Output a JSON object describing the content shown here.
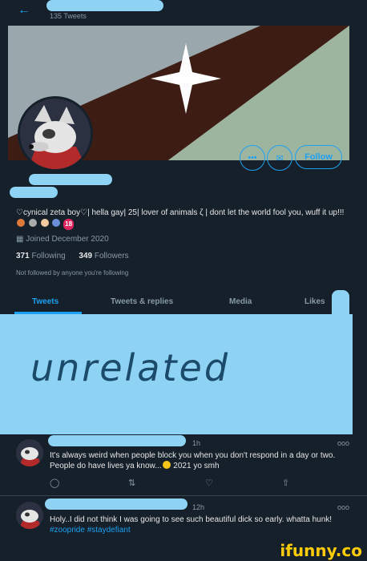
{
  "header": {
    "back_icon": "arrow-left-icon",
    "tweets_count": "135 Tweets"
  },
  "banner": {
    "colors": [
      "#c7d0d0",
      "#3d1d13",
      "#9db59f"
    ]
  },
  "profile": {
    "more_label": "•••",
    "follow_label": "Follow",
    "bio": "cynical zeta boy♡| hella gay| 25| lover of animals ζ | dont let the world fool you, wuff it up!!!",
    "bio_badge": "18",
    "joined": "Joined December 2020",
    "following_count": "371",
    "following_label": "Following",
    "followers_count": "349",
    "followers_label": "Followers",
    "not_followed": "Not followed by anyone you're following"
  },
  "tabs": [
    {
      "label": "Tweets",
      "active": true
    },
    {
      "label": "Tweets & replies",
      "active": false
    },
    {
      "label": "Media",
      "active": false
    },
    {
      "label": "Likes",
      "active": false
    }
  ],
  "overlay_text": "unrelated",
  "tweets": [
    {
      "time": "1h",
      "more": "ooo",
      "text": "It's always weird when people block you when you don't respond in a day or two. People do have lives ya know...",
      "text_suffix": " 2021 yo smh"
    },
    {
      "time": "12h",
      "more": "ooo",
      "text": "Holy..I did not think I was going to see such beautiful dick so early. whatta hunk! ",
      "hashtags": "#zoopride #staydefiant"
    }
  ],
  "watermark": "ifunny.co"
}
